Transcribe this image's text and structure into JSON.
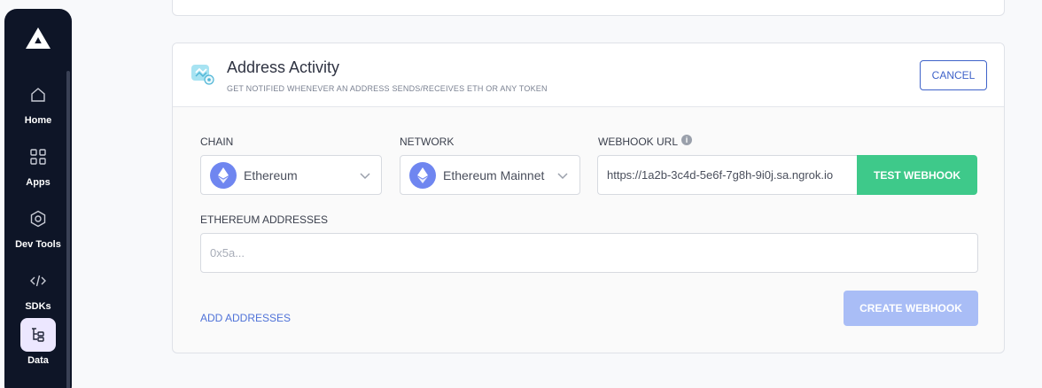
{
  "sidebar": {
    "items": [
      {
        "label": "Home",
        "icon": "home-icon"
      },
      {
        "label": "Apps",
        "icon": "grid-icon"
      },
      {
        "label": "Dev Tools",
        "icon": "hexagon-icon"
      },
      {
        "label": "SDKs",
        "icon": "code-icon"
      },
      {
        "label": "Data",
        "icon": "tree-icon",
        "active": true
      }
    ]
  },
  "card": {
    "title": "Address Activity",
    "subtitle": "GET NOTIFIED WHENEVER AN ADDRESS SENDS/RECEIVES ETH OR ANY TOKEN",
    "cancel_label": "CANCEL"
  },
  "form": {
    "chain": {
      "label": "CHAIN",
      "value": "Ethereum"
    },
    "network": {
      "label": "NETWORK",
      "value": "Ethereum Mainnet"
    },
    "webhook_url": {
      "label": "WEBHOOK URL",
      "value": "https://1a2b-3c4d-5e6f-7g8h-9i0j.sa.ngrok.io"
    },
    "test_label": "TEST WEBHOOK",
    "addresses": {
      "label": "ETHEREUM ADDRESSES",
      "placeholder": "0x5a..."
    },
    "add_label": "ADD ADDRESSES",
    "create_label": "CREATE WEBHOOK"
  },
  "colors": {
    "sidebar_bg": "#0e1527",
    "accent_blue": "#3f63c9",
    "test_green": "#3ec98a",
    "create_disabled": "#a9bdf6",
    "eth_badge": "#6f86f0"
  }
}
